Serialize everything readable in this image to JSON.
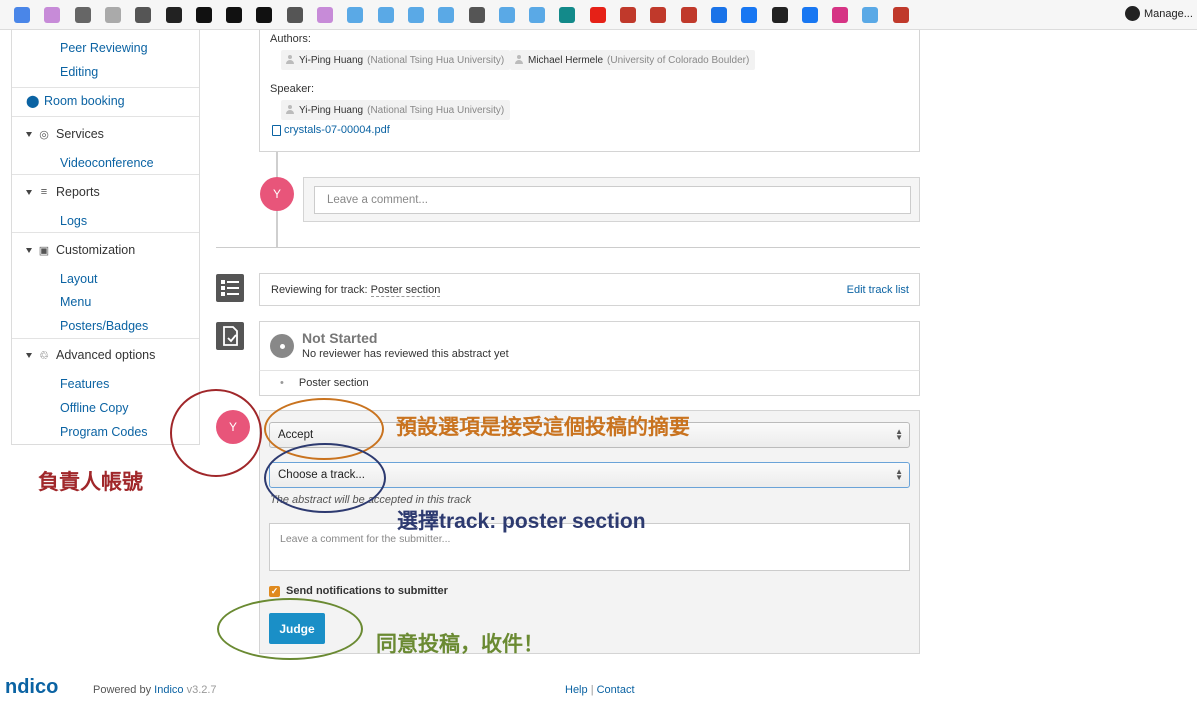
{
  "bookmarks_bar": {
    "icons": [
      {
        "name": "calendar-icon",
        "color": "#4a86e8"
      },
      {
        "name": "flower-icon",
        "color": "#c78bd8"
      },
      {
        "name": "c-app-icon",
        "color": "#666666"
      },
      {
        "name": "chat-icon",
        "color": "#aaaaaa"
      },
      {
        "name": "book-icon",
        "color": "#555555"
      },
      {
        "name": "circle-logo-icon",
        "color": "#222222"
      },
      {
        "name": "github-icon",
        "color": "#111111"
      },
      {
        "name": "github-icon",
        "color": "#111111"
      },
      {
        "name": "github-icon",
        "color": "#111111"
      },
      {
        "name": "book-icon",
        "color": "#555555"
      },
      {
        "name": "flower-icon",
        "color": "#c78bd8"
      },
      {
        "name": "x-icon",
        "color": "#5aa9e6"
      },
      {
        "name": "code-icon",
        "color": "#5aa9e6"
      },
      {
        "name": "x-icon",
        "color": "#5aa9e6"
      },
      {
        "name": "x-icon",
        "color": "#5aa9e6"
      },
      {
        "name": "book-icon",
        "color": "#555555"
      },
      {
        "name": "x-icon",
        "color": "#5aa9e6"
      },
      {
        "name": "x-icon",
        "color": "#5aa9e6"
      },
      {
        "name": "teal-app-icon",
        "color": "#138a8a"
      },
      {
        "name": "youtube-icon",
        "color": "#e62117"
      },
      {
        "name": "red-diamond-icon",
        "color": "#c0392b"
      },
      {
        "name": "red-diamond-icon",
        "color": "#c0392b"
      },
      {
        "name": "red-diamond-icon",
        "color": "#c0392b"
      },
      {
        "name": "g-app-icon",
        "color": "#1a73e8"
      },
      {
        "name": "facebook-icon",
        "color": "#1877f2"
      },
      {
        "name": "circle-logo-icon",
        "color": "#222222"
      },
      {
        "name": "facebook-icon",
        "color": "#1877f2"
      },
      {
        "name": "heart-app-icon",
        "color": "#d63384"
      },
      {
        "name": "x-icon",
        "color": "#5aa9e6"
      },
      {
        "name": "number-24-icon",
        "color": "#c0392b"
      }
    ],
    "manage_label": "Manage..."
  },
  "sidebar": {
    "items": [
      {
        "label": "Peer Reviewing"
      },
      {
        "label": "Editing"
      },
      {
        "label": "Room booking"
      },
      {
        "label": "Services"
      },
      {
        "label": "Videoconference"
      },
      {
        "label": "Reports"
      },
      {
        "label": "Logs"
      },
      {
        "label": "Customization"
      },
      {
        "label": "Layout"
      },
      {
        "label": "Menu"
      },
      {
        "label": "Posters/Badges"
      },
      {
        "label": "Advanced options"
      },
      {
        "label": "Features"
      },
      {
        "label": "Offline Copy"
      },
      {
        "label": "Program Codes"
      }
    ]
  },
  "abstract": {
    "authors_label": "Authors:",
    "authors": [
      {
        "name": "Yi-Ping Huang",
        "affiliation": "(National Tsing Hua University)"
      },
      {
        "name": "Michael Hermele",
        "affiliation": "(University of Colorado Boulder)"
      }
    ],
    "speaker_label": "Speaker:",
    "speaker": {
      "name": "Yi-Ping Huang",
      "affiliation": "(National Tsing Hua University)"
    },
    "attachment": "crystals-07-00004.pdf"
  },
  "comment": {
    "avatar_initial": "Y",
    "placeholder": "Leave a comment..."
  },
  "review": {
    "track_label": "Reviewing for track:",
    "track_name": "Poster section",
    "edit_track_list": "Edit track list",
    "status_title": "Not Started",
    "status_desc": "No reviewer has reviewed this abstract yet",
    "bullet_track": "Poster section"
  },
  "judgment": {
    "avatar_initial": "Y",
    "action_select": "Accept",
    "track_select": "Choose a track...",
    "track_hint": "The abstract will be accepted in this track",
    "comment_placeholder": "Leave a comment for the submitter...",
    "notify_label": "Send notifications to submitter",
    "notify_checked": true,
    "judge_button": "Judge"
  },
  "annotations": {
    "default_option": "預設選項是接受這個投稿的摘要",
    "select_track": "選擇track: poster section",
    "person_in_charge": "負責人帳號",
    "agree": "同意投稿，收件！"
  },
  "colors": {
    "brand_link": "#0b63a3",
    "judge_button": "#1a8fc7",
    "avatar": "#e8557a",
    "anno_orange": "#c9731f",
    "anno_navy": "#2d3a70",
    "anno_red": "#a0272a",
    "anno_green": "#6a8a32"
  },
  "footer": {
    "logo_text": "ndico",
    "powered_by": "Powered by",
    "indico_link": "Indico",
    "version": "v3.2.7",
    "help": "Help",
    "separator": "|",
    "contact": "Contact"
  }
}
